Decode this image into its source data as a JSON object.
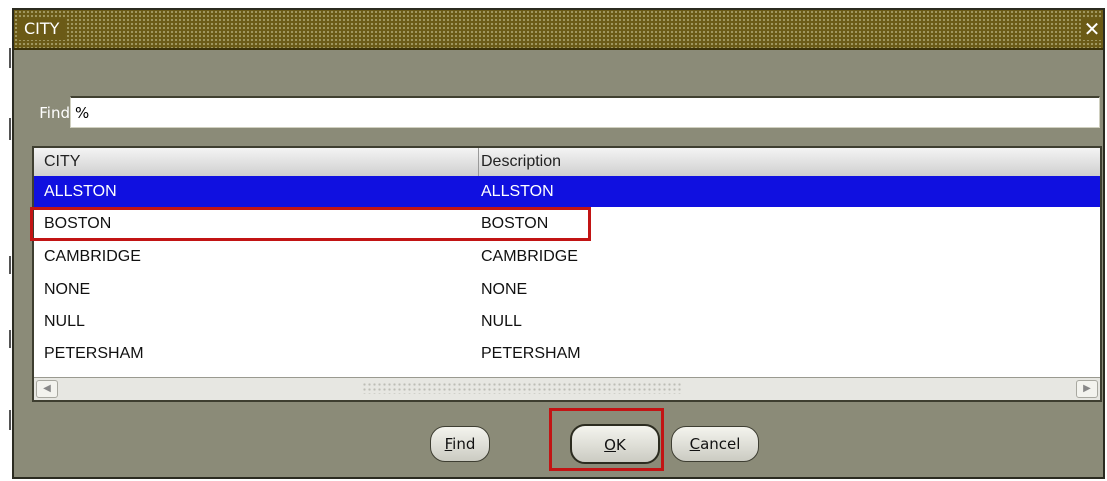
{
  "dialog": {
    "title": "CITY",
    "close_glyph": "✕"
  },
  "find": {
    "label": "Find",
    "value": "%"
  },
  "list": {
    "columns": [
      "CITY",
      "Description"
    ],
    "rows": [
      {
        "city": "ALLSTON",
        "description": "ALLSTON",
        "selected": true
      },
      {
        "city": "BOSTON",
        "description": "BOSTON",
        "selected": false
      },
      {
        "city": "CAMBRIDGE",
        "description": "CAMBRIDGE",
        "selected": false
      },
      {
        "city": "NONE",
        "description": "NONE",
        "selected": false
      },
      {
        "city": "NULL",
        "description": "NULL",
        "selected": false
      },
      {
        "city": "PETERSHAM",
        "description": "PETERSHAM",
        "selected": false
      }
    ],
    "scroll_left_glyph": "◀",
    "scroll_right_glyph": "▶"
  },
  "buttons": {
    "find_mnemonic": "F",
    "find_rest": "ind",
    "ok_mnemonic": "O",
    "ok_rest": "K",
    "cancel_mnemonic": "C",
    "cancel_rest": "ancel"
  },
  "colors": {
    "selection": "#1010e0",
    "dialog_bg": "#8b8b78",
    "titlebar": "#6b5a16",
    "highlight": "#c21414"
  }
}
